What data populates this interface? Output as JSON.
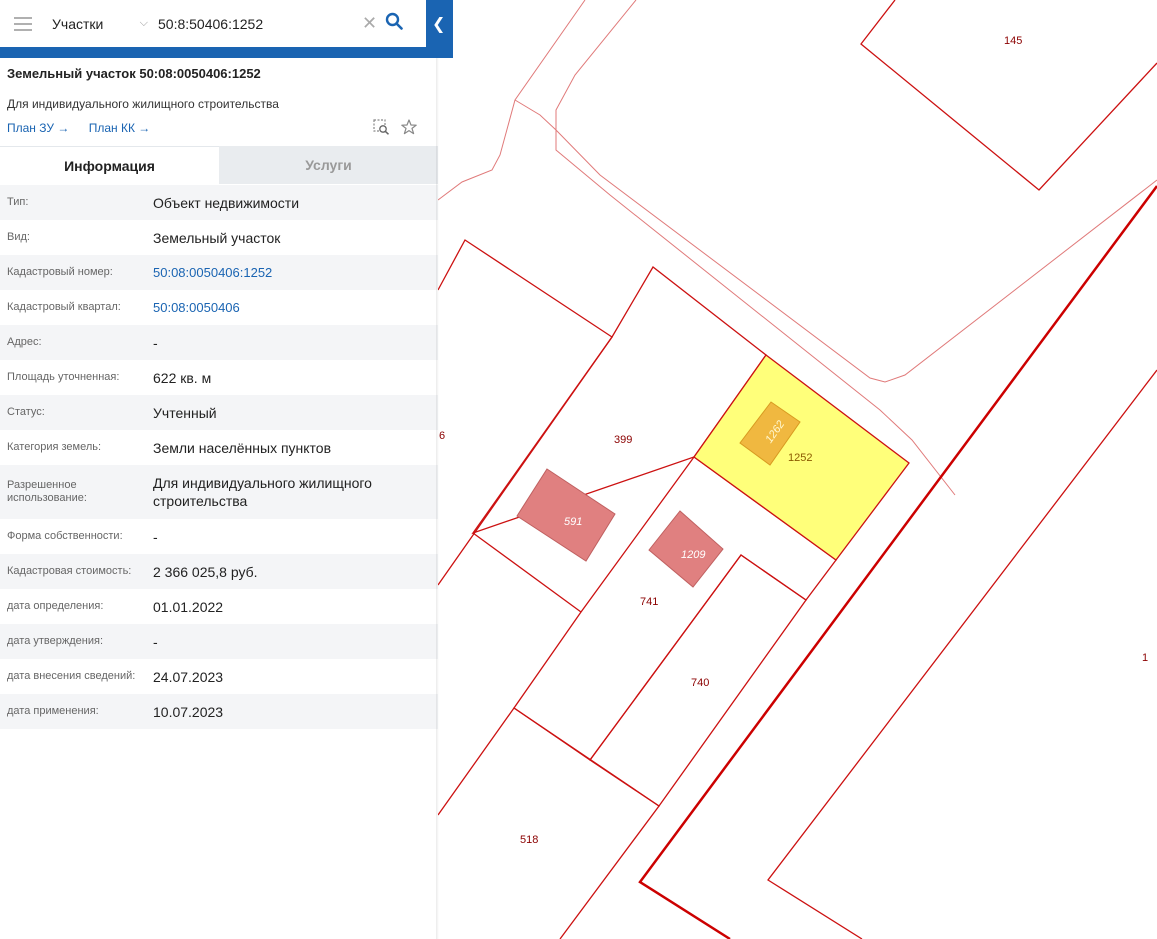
{
  "search": {
    "layer": "Участки",
    "query": "50:8:50406:1252"
  },
  "header": {
    "title": "Земельный участок 50:08:0050406:1252",
    "subtitle": "Для индивидуального жилищного строительства",
    "link_plan_zu": "План ЗУ →",
    "link_plan_kk": "План КК →"
  },
  "tabs": {
    "info": "Информация",
    "services": "Услуги"
  },
  "rows": [
    {
      "label": "Тип:",
      "value": "Объект недвижимости"
    },
    {
      "label": "Вид:",
      "value": "Земельный участок"
    },
    {
      "label": "Кадастровый номер:",
      "value": "50:08:0050406:1252"
    },
    {
      "label": "Кадастровый квартал:",
      "value": "50:08:0050406"
    },
    {
      "label": "Адрес:",
      "value": "-"
    },
    {
      "label": "Площадь уточненная:",
      "value": "622 кв. м"
    },
    {
      "label": "Статус:",
      "value": "Учтенный"
    },
    {
      "label": "Категория земель:",
      "value": "Земли населённых пунктов"
    },
    {
      "label": "Разрешенное использование:",
      "value": "Для индивидуального жилищного строительства"
    },
    {
      "label": "Форма собственности:",
      "value": "-"
    },
    {
      "label": "Кадастровая стоимость:",
      "value": "2 366 025,8 руб."
    },
    {
      "label": "дата определения:",
      "value": "01.01.2022"
    },
    {
      "label": "дата утверждения:",
      "value": "-"
    },
    {
      "label": "дата внесения сведений:",
      "value": "24.07.2023"
    },
    {
      "label": "дата применения:",
      "value": "10.07.2023"
    }
  ],
  "map": {
    "labels": {
      "p145": "145",
      "p399": "399",
      "p1252": "1252",
      "p741": "741",
      "p740": "740",
      "p518": "518",
      "p1": "1",
      "p6": "6"
    },
    "buildings": {
      "b591": "591",
      "b1209": "1209",
      "b1262": "1262"
    },
    "colors": {
      "boundary": "#cc0000",
      "selected_fill": "#ffff7a",
      "building_fill": "#e08080",
      "selected_building": "#f0b840"
    }
  }
}
